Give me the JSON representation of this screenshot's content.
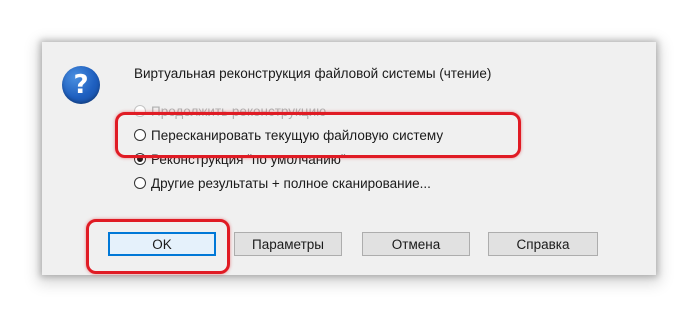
{
  "dialog": {
    "message": "Виртуальная реконструкция файловой системы (чтение)",
    "icon": "question-icon",
    "icon_glyph": "?",
    "options": [
      {
        "label": "Продолжить реконструкцию",
        "checked": false,
        "disabled": true
      },
      {
        "label": "Пересканировать текущую файловую систему",
        "checked": false,
        "disabled": false
      },
      {
        "label": "Реконструкция \"по умолчанию\"",
        "checked": true,
        "disabled": false
      },
      {
        "label": "Другие результаты + полное сканирование...",
        "checked": false,
        "disabled": false
      }
    ],
    "buttons": {
      "ok": "OK",
      "parameters": "Параметры",
      "cancel": "Отмена",
      "help": "Справка"
    }
  },
  "colors": {
    "highlight": "#e01b24",
    "icon_blue": "#1e5fbf",
    "default_button_border": "#0078d7"
  }
}
